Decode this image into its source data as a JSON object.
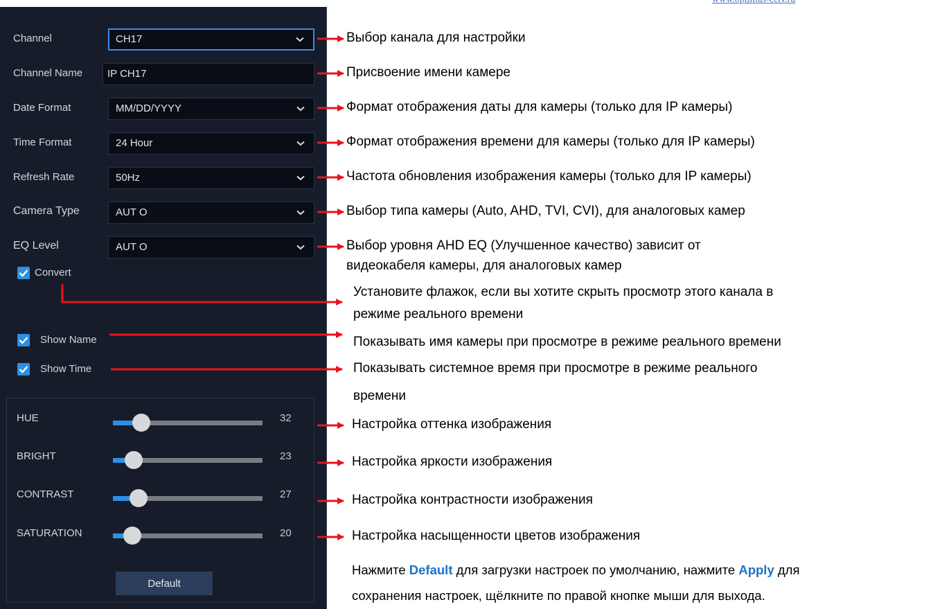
{
  "watermark": "www.optimus-cctv.ru",
  "settings": {
    "channel": {
      "label": "Channel",
      "value": "CH17"
    },
    "channel_name": {
      "label": "Channel Name",
      "value": "IP CH17"
    },
    "date_format": {
      "label": "Date Format",
      "value": "MM/DD/YYYY"
    },
    "time_format": {
      "label": "Time Format",
      "value": "24 Hour"
    },
    "refresh_rate": {
      "label": "Refresh Rate",
      "value": "50Hz"
    },
    "camera_type": {
      "label": "Camera Type",
      "value": "AUT O"
    },
    "eq_level": {
      "label": "EQ Level",
      "value": "AUT O"
    }
  },
  "checkboxes": {
    "convert": {
      "label": "Convert",
      "checked": true
    },
    "show_name": {
      "label": "Show Name",
      "checked": true
    },
    "show_time": {
      "label": "Show Time",
      "checked": true
    }
  },
  "sliders": {
    "hue": {
      "label": "HUE",
      "value": "32",
      "level": 0.19
    },
    "bright": {
      "label": "BRIGHT",
      "value": "23",
      "level": 0.14
    },
    "contrast": {
      "label": "CONTRAST",
      "value": "27",
      "level": 0.17
    },
    "saturation": {
      "label": "SATURATION",
      "value": "20",
      "level": 0.13
    }
  },
  "buttons": {
    "default": "Default"
  },
  "annotations": {
    "channel": "Выбор канала для настройки",
    "channel_name": "Присвоение имени камере",
    "date_format": "Формат отображения даты для камеры (только для IP камеры)",
    "time_format": "Формат отображения времени для камеры (только для IP камеры)",
    "refresh_rate": "Частота обновления изображения камеры (только для IP камеры)",
    "camera_type": "Выбор типа камеры (Auto, AHD, TVI, CVI), для аналоговых камер",
    "eq_level_1": "Выбор уровня AHD EQ (Улучшенное качество) зависит от",
    "eq_level_2": "видеокабеля камеры, для аналоговых камер",
    "convert_1": "Установите флажок, если вы хотите скрыть просмотр этого канала в",
    "convert_2": "режиме реального времени",
    "show_name": "Показывать имя камеры при просмотре в режиме реального времени",
    "show_time_1": "Показывать системное время при просмотре в режиме реального",
    "show_time_2": "времени",
    "hue": "Настройка оттенка изображения",
    "bright": "Настройка яркости изображения",
    "contrast": "Настройка контрастности изображения",
    "saturation": "Настройка насыщенности цветов изображения",
    "footer": {
      "p1": "Нажмите ",
      "default_kw": "Default",
      "p2": " для загрузки настроек по умолчанию, нажмите ",
      "apply_kw": "Apply",
      "p3": " для",
      "line2": "сохранения настроек, щёлкните по правой кнопке мыши для выхода."
    }
  },
  "colors": {
    "panel_bg": "#171c2a",
    "accent": "#2e8fe6",
    "arrow": "#e8141c",
    "keyword": "#1a73c8"
  },
  "icons": {
    "dropdown": "chevron-down-icon",
    "checkbox": "checkmark-icon"
  }
}
